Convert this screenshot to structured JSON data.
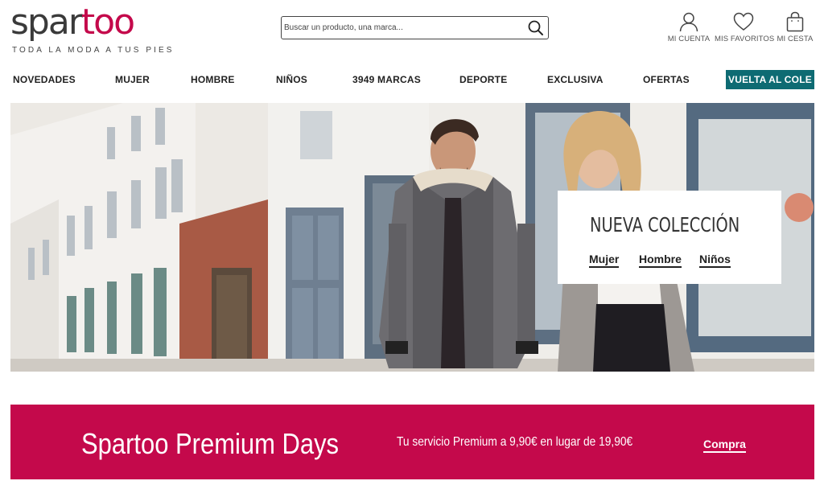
{
  "brand": {
    "logo_part1": "spar",
    "logo_part2": "too",
    "tagline": "TODA LA MODA A TUS PIES",
    "colors": {
      "primary": "#c4094b",
      "dark": "#3a3a3a",
      "promo": "#0e6b73"
    }
  },
  "search": {
    "placeholder": "Buscar un producto, una marca...",
    "value": "",
    "icon": "search-icon"
  },
  "account": [
    {
      "label": "MI CUENTA",
      "icon": "user-icon"
    },
    {
      "label": "MIS FAVORITOS",
      "icon": "heart-icon"
    },
    {
      "label": "MI CESTA",
      "icon": "bag-icon"
    }
  ],
  "nav": [
    "NOVEDADES",
    "MUJER",
    "HOMBRE",
    "NIÑOS",
    "3949 MARCAS",
    "DEPORTE",
    "EXCLUSIVA",
    "OFERTAS"
  ],
  "nav_promo": "VUELTA AL COLE",
  "hero": {
    "title": "NUEVA COLECCIÓN",
    "links": [
      "Mujer",
      "Hombre",
      "Niños"
    ]
  },
  "premium": {
    "title": "Spartoo Premium Days",
    "text": "Tu servicio Premium a 9,90€ en lugar de 19,90€",
    "cta": "Compra"
  }
}
